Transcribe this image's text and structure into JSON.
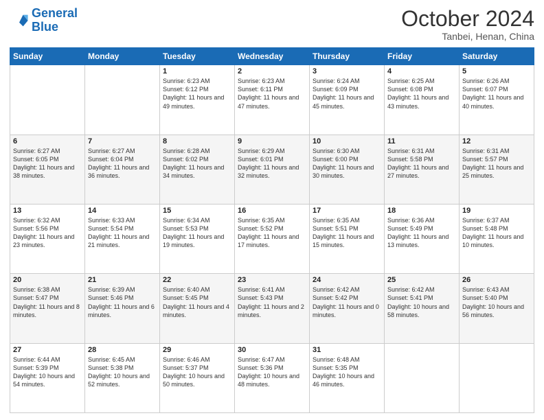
{
  "logo": {
    "line1": "General",
    "line2": "Blue"
  },
  "header": {
    "month": "October 2024",
    "location": "Tanbei, Henan, China"
  },
  "weekdays": [
    "Sunday",
    "Monday",
    "Tuesday",
    "Wednesday",
    "Thursday",
    "Friday",
    "Saturday"
  ],
  "weeks": [
    [
      {
        "day": "",
        "info": ""
      },
      {
        "day": "",
        "info": ""
      },
      {
        "day": "1",
        "info": "Sunrise: 6:23 AM\nSunset: 6:12 PM\nDaylight: 11 hours and 49 minutes."
      },
      {
        "day": "2",
        "info": "Sunrise: 6:23 AM\nSunset: 6:11 PM\nDaylight: 11 hours and 47 minutes."
      },
      {
        "day": "3",
        "info": "Sunrise: 6:24 AM\nSunset: 6:09 PM\nDaylight: 11 hours and 45 minutes."
      },
      {
        "day": "4",
        "info": "Sunrise: 6:25 AM\nSunset: 6:08 PM\nDaylight: 11 hours and 43 minutes."
      },
      {
        "day": "5",
        "info": "Sunrise: 6:26 AM\nSunset: 6:07 PM\nDaylight: 11 hours and 40 minutes."
      }
    ],
    [
      {
        "day": "6",
        "info": "Sunrise: 6:27 AM\nSunset: 6:05 PM\nDaylight: 11 hours and 38 minutes."
      },
      {
        "day": "7",
        "info": "Sunrise: 6:27 AM\nSunset: 6:04 PM\nDaylight: 11 hours and 36 minutes."
      },
      {
        "day": "8",
        "info": "Sunrise: 6:28 AM\nSunset: 6:02 PM\nDaylight: 11 hours and 34 minutes."
      },
      {
        "day": "9",
        "info": "Sunrise: 6:29 AM\nSunset: 6:01 PM\nDaylight: 11 hours and 32 minutes."
      },
      {
        "day": "10",
        "info": "Sunrise: 6:30 AM\nSunset: 6:00 PM\nDaylight: 11 hours and 30 minutes."
      },
      {
        "day": "11",
        "info": "Sunrise: 6:31 AM\nSunset: 5:58 PM\nDaylight: 11 hours and 27 minutes."
      },
      {
        "day": "12",
        "info": "Sunrise: 6:31 AM\nSunset: 5:57 PM\nDaylight: 11 hours and 25 minutes."
      }
    ],
    [
      {
        "day": "13",
        "info": "Sunrise: 6:32 AM\nSunset: 5:56 PM\nDaylight: 11 hours and 23 minutes."
      },
      {
        "day": "14",
        "info": "Sunrise: 6:33 AM\nSunset: 5:54 PM\nDaylight: 11 hours and 21 minutes."
      },
      {
        "day": "15",
        "info": "Sunrise: 6:34 AM\nSunset: 5:53 PM\nDaylight: 11 hours and 19 minutes."
      },
      {
        "day": "16",
        "info": "Sunrise: 6:35 AM\nSunset: 5:52 PM\nDaylight: 11 hours and 17 minutes."
      },
      {
        "day": "17",
        "info": "Sunrise: 6:35 AM\nSunset: 5:51 PM\nDaylight: 11 hours and 15 minutes."
      },
      {
        "day": "18",
        "info": "Sunrise: 6:36 AM\nSunset: 5:49 PM\nDaylight: 11 hours and 13 minutes."
      },
      {
        "day": "19",
        "info": "Sunrise: 6:37 AM\nSunset: 5:48 PM\nDaylight: 11 hours and 10 minutes."
      }
    ],
    [
      {
        "day": "20",
        "info": "Sunrise: 6:38 AM\nSunset: 5:47 PM\nDaylight: 11 hours and 8 minutes."
      },
      {
        "day": "21",
        "info": "Sunrise: 6:39 AM\nSunset: 5:46 PM\nDaylight: 11 hours and 6 minutes."
      },
      {
        "day": "22",
        "info": "Sunrise: 6:40 AM\nSunset: 5:45 PM\nDaylight: 11 hours and 4 minutes."
      },
      {
        "day": "23",
        "info": "Sunrise: 6:41 AM\nSunset: 5:43 PM\nDaylight: 11 hours and 2 minutes."
      },
      {
        "day": "24",
        "info": "Sunrise: 6:42 AM\nSunset: 5:42 PM\nDaylight: 11 hours and 0 minutes."
      },
      {
        "day": "25",
        "info": "Sunrise: 6:42 AM\nSunset: 5:41 PM\nDaylight: 10 hours and 58 minutes."
      },
      {
        "day": "26",
        "info": "Sunrise: 6:43 AM\nSunset: 5:40 PM\nDaylight: 10 hours and 56 minutes."
      }
    ],
    [
      {
        "day": "27",
        "info": "Sunrise: 6:44 AM\nSunset: 5:39 PM\nDaylight: 10 hours and 54 minutes."
      },
      {
        "day": "28",
        "info": "Sunrise: 6:45 AM\nSunset: 5:38 PM\nDaylight: 10 hours and 52 minutes."
      },
      {
        "day": "29",
        "info": "Sunrise: 6:46 AM\nSunset: 5:37 PM\nDaylight: 10 hours and 50 minutes."
      },
      {
        "day": "30",
        "info": "Sunrise: 6:47 AM\nSunset: 5:36 PM\nDaylight: 10 hours and 48 minutes."
      },
      {
        "day": "31",
        "info": "Sunrise: 6:48 AM\nSunset: 5:35 PM\nDaylight: 10 hours and 46 minutes."
      },
      {
        "day": "",
        "info": ""
      },
      {
        "day": "",
        "info": ""
      }
    ]
  ]
}
